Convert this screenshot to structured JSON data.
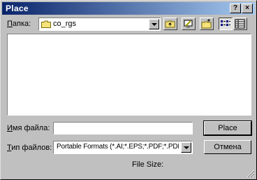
{
  "dialog": {
    "title": "Place",
    "title_buttons": {
      "help": "?",
      "close": "×"
    }
  },
  "lookin": {
    "label_prefix": "",
    "label_hotkey": "П",
    "label_rest": "апка:",
    "folder_name": "co_rgs",
    "folder_icon": "folder-icon"
  },
  "toolbar": {
    "up_icon": "up-folder-icon",
    "desktop_icon": "desktop-icon",
    "new_folder_icon": "new-folder-icon",
    "list_view_icon": "list-view-icon",
    "details_view_icon": "details-view-icon"
  },
  "filename": {
    "label_hotkey": "И",
    "label_rest": "мя файла:",
    "value": ""
  },
  "filetype": {
    "label_hotkey": "Т",
    "label_rest": "ип файлов:",
    "value": "Portable Formats (*.AI;*.EPS;*.PDF;*.PDP)"
  },
  "buttons": {
    "place": "Place",
    "cancel": "Отмена"
  },
  "file_size_label": "File Size:"
}
